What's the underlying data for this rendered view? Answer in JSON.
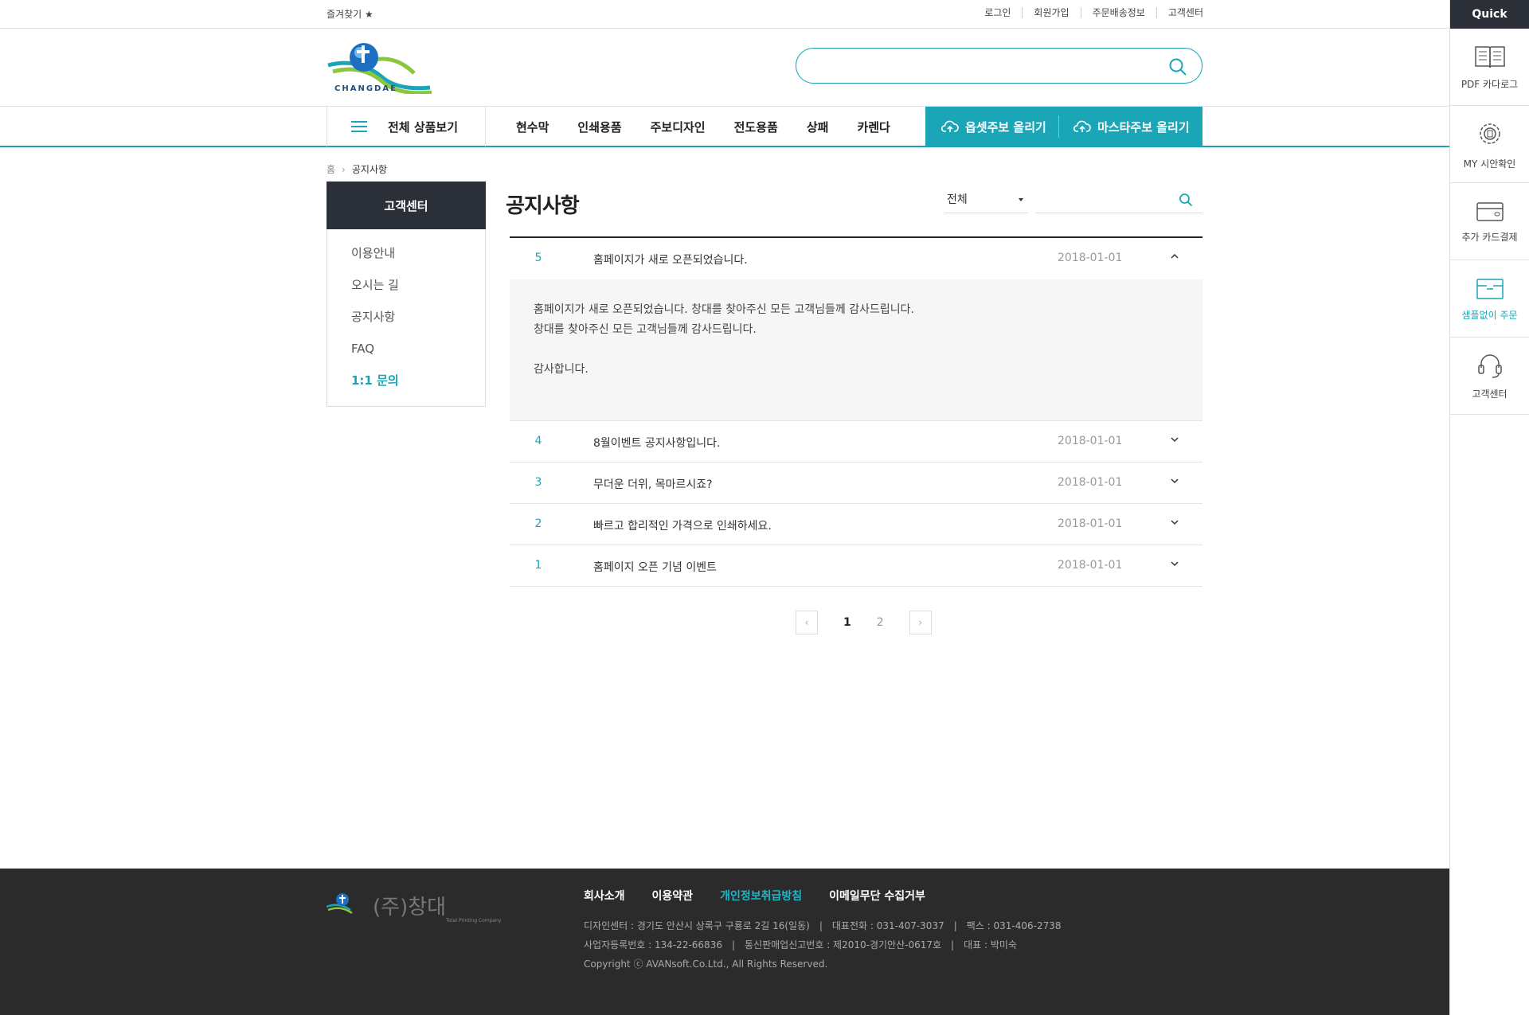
{
  "topbar": {
    "favorite": "즐겨찾기 ★",
    "links": [
      "로그인",
      "회원가입",
      "주문배송정보",
      "고객센터"
    ]
  },
  "header": {
    "logo_text": "CHANGDAE",
    "search_placeholder": ""
  },
  "nav": {
    "all_products": "전체 상품보기",
    "menu": [
      "현수막",
      "인쇄용품",
      "주보디자인",
      "전도용품",
      "상패",
      "카렌다"
    ],
    "upload_offset": "옵셋주보 올리기",
    "upload_master": "마스타주보 올리기"
  },
  "breadcrumb": {
    "home": "홈",
    "current": "공지사항"
  },
  "sidebar": {
    "title": "고객센터",
    "items": [
      "이용안내",
      "오시는 길",
      "공지사항",
      "FAQ",
      "1:1 문의"
    ]
  },
  "board": {
    "title": "공지사항",
    "filter": "전체",
    "search_placeholder": "",
    "rows": [
      {
        "num": "5",
        "title": "홈페이지가 새로 오픈되었습니다.",
        "date": "2018-01-01"
      },
      {
        "num": "4",
        "title": "8월이벤트 공지사항입니다.",
        "date": "2018-01-01"
      },
      {
        "num": "3",
        "title": "무더운 더위, 목마르시죠?",
        "date": "2018-01-01"
      },
      {
        "num": "2",
        "title": "빠르고 합리적인 가격으로 인쇄하세요.",
        "date": "2018-01-01"
      },
      {
        "num": "1",
        "title": "홈페이지 오픈 기념 이벤트",
        "date": "2018-01-01"
      }
    ],
    "detail": {
      "line1": "홈페이지가 새로 오픈되었습니다. 창대를 찾아주신 모든 고객님들께 감사드립니다.",
      "line2": "창대를 찾아주신 모든 고객님들께 감사드립니다.",
      "line3": "감사합니다."
    }
  },
  "pagination": {
    "pages": [
      "1",
      "2"
    ],
    "current": "1",
    "prev": "‹",
    "next": "›"
  },
  "footer": {
    "logo_mark": "(주)창대",
    "logo_sub": "Total Printing Company",
    "links": [
      "회사소개",
      "이용약관",
      "개인정보취급방침",
      "이메일무단 수집거부"
    ],
    "design_center": "디자인센터 : 경기도 안산시 상록구 구룡로 2길 16(일동)",
    "phone": "대표전화 : 031-407-3037",
    "fax": "팩스 : 031-406-2738",
    "biz_no": "사업자등록번호 : 134-22-66836",
    "mail_order": "통신판매업신고번호 : 제2010-경기안산-0617호",
    "ceo": "대표 : 박미숙",
    "copyright": "Copyright ⓒ AVANsoft.Co.Ltd., All Rights Reserved."
  },
  "quick": {
    "title": "Quick",
    "items": [
      "PDF 카다로그",
      "MY 시안확인",
      "추가 카드결제",
      "샘플없이 주문",
      "고객센터"
    ]
  },
  "colors": {
    "accent": "#1aa6b7",
    "dark": "#2b3038",
    "footer": "#2b2b2b"
  }
}
